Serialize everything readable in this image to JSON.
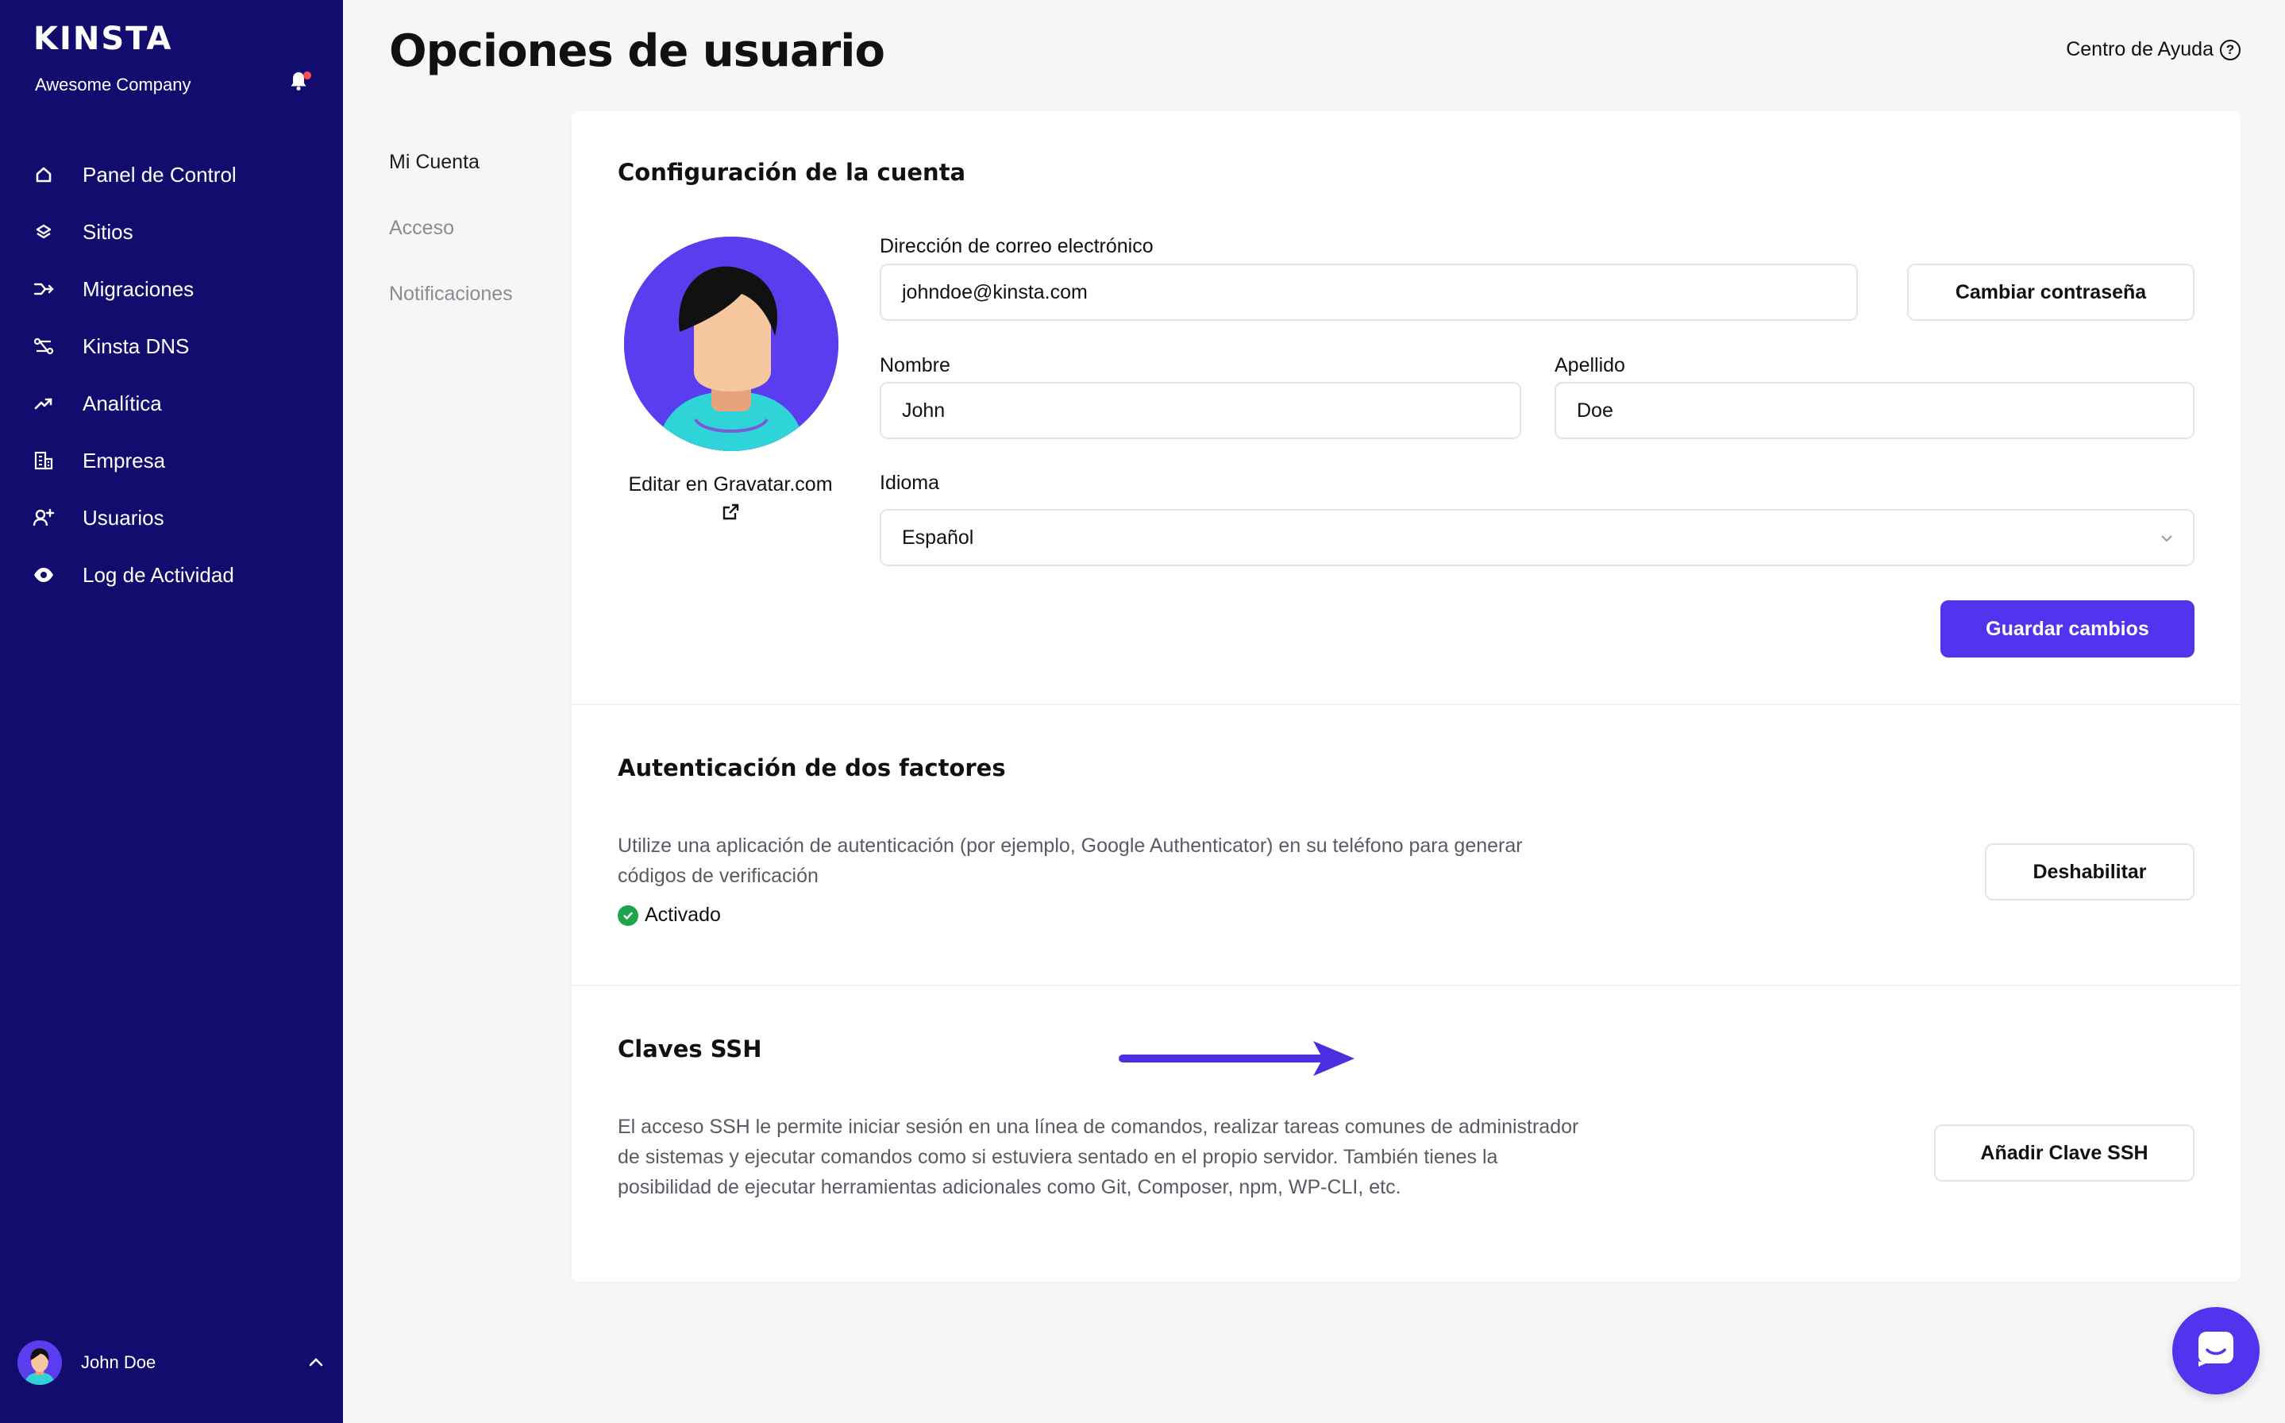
{
  "brand": {
    "logo": "KINSTA",
    "company": "Awesome Company",
    "sidebar_color": "#110c6e",
    "accent": "#5333ed"
  },
  "sidebar": {
    "items": [
      {
        "label": "Panel de Control",
        "icon": "home-icon"
      },
      {
        "label": "Sitios",
        "icon": "layers-icon"
      },
      {
        "label": "Migraciones",
        "icon": "migrate-icon"
      },
      {
        "label": "Kinsta DNS",
        "icon": "dns-icon"
      },
      {
        "label": "Analítica",
        "icon": "trend-icon"
      },
      {
        "label": "Empresa",
        "icon": "building-icon"
      },
      {
        "label": "Usuarios",
        "icon": "user-add-icon"
      },
      {
        "label": "Log de Actividad",
        "icon": "eye-icon"
      }
    ],
    "user": {
      "name": "John Doe"
    }
  },
  "header": {
    "title": "Opciones de usuario",
    "help": "Centro de Ayuda"
  },
  "subnav": {
    "items": [
      "Mi Cuenta",
      "Acceso",
      "Notificaciones"
    ],
    "active": "Mi Cuenta"
  },
  "account": {
    "title": "Configuración de la cuenta",
    "gravatar_link": "Editar en Gravatar.com",
    "email_label": "Dirección de correo electrónico",
    "email_value": "johndoe@kinsta.com",
    "change_password": "Cambiar contraseña",
    "first_name_label": "Nombre",
    "first_name_value": "John",
    "last_name_label": "Apellido",
    "last_name_value": "Doe",
    "language_label": "Idioma",
    "language_value": "Español",
    "save": "Guardar cambios"
  },
  "twofa": {
    "title": "Autenticación de dos factores",
    "description_line1": "Utilize una aplicación de autenticación (por ejemplo, Google Authenticator) en su teléfono para generar",
    "description_line2": "códigos de verificación",
    "status": "Activado",
    "status_color": "#1ea44b",
    "button": "Deshabilitar"
  },
  "ssh": {
    "title": "Claves SSH",
    "description_line1": "El acceso SSH le permite iniciar sesión en una línea de comandos, realizar tareas comunes de administrador",
    "description_line2": "de sistemas y ejecutar comandos como si estuviera sentado en el propio servidor. También tienes la",
    "description_line3": "posibilidad de ejecutar herramientas adicionales como Git, Composer, npm, WP-CLI, etc.",
    "button": "Añadir Clave SSH"
  }
}
